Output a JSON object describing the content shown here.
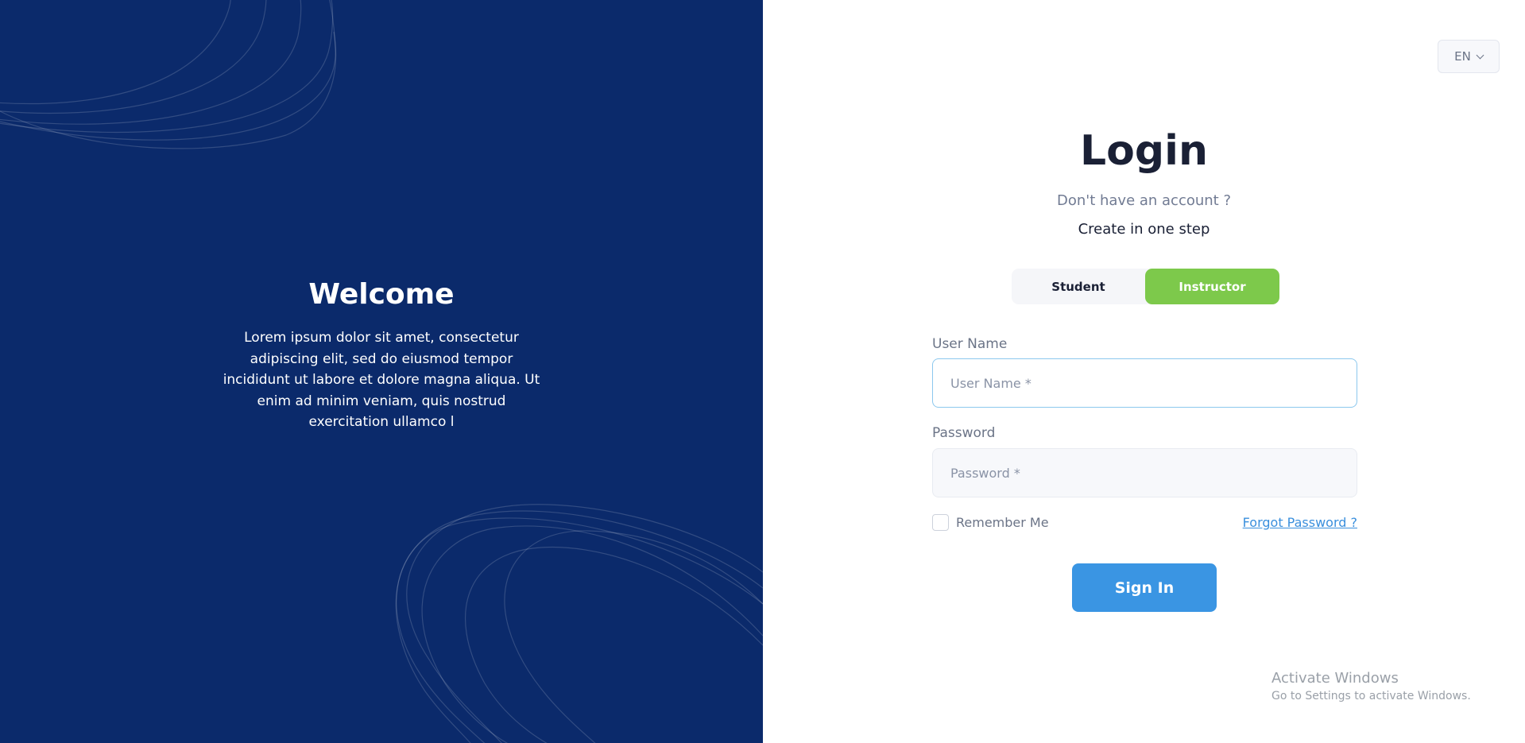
{
  "left": {
    "title": "Welcome",
    "body": "Lorem ipsum dolor sit amet, consectetur adipiscing elit, sed do eiusmod tempor incididunt ut labore et dolore magna aliqua. Ut enim ad minim veniam, quis nostrud exercitation ullamco l",
    "background_color": "#0b2a6b"
  },
  "language": {
    "selected": "EN",
    "icon": "chevron-down-icon"
  },
  "login": {
    "title": "Login",
    "no_account": "Don't have an account ?",
    "create_link": "Create in one step",
    "roles": [
      {
        "label": "Student",
        "active": false
      },
      {
        "label": "Instructor",
        "active": true
      }
    ],
    "active_color": "#7dc94b"
  },
  "form": {
    "username_label": "User Name",
    "username_placeholder": "User Name *",
    "username_value": "",
    "password_label": "Password",
    "password_placeholder": "Password *",
    "password_value": "",
    "remember_label": "Remember Me",
    "remember_checked": false,
    "forgot_label": "Forgot Password ?",
    "signin_label": "Sign In",
    "button_color": "#3a95e3"
  },
  "watermark": {
    "title": "Activate Windows",
    "subtitle": "Go to Settings to activate Windows."
  }
}
